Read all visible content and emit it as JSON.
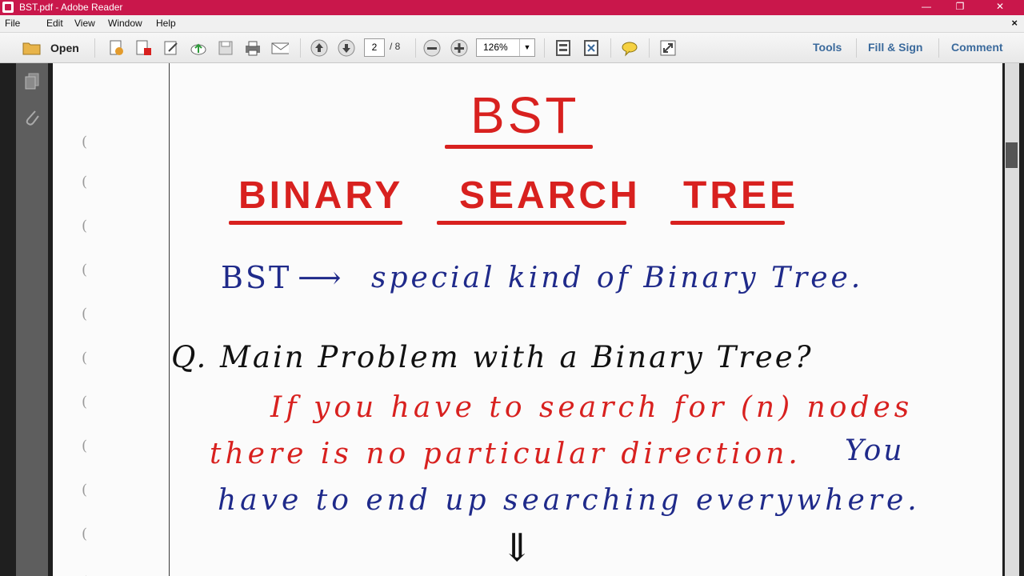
{
  "window": {
    "title": "BST.pdf - Adobe Reader"
  },
  "menu": [
    "File",
    "Edit",
    "View",
    "Window",
    "Help"
  ],
  "toolbar": {
    "open_label": "Open",
    "page_current": "2",
    "page_total": "/ 8",
    "zoom": "126%",
    "tools_label": "Tools",
    "fill_sign_label": "Fill & Sign",
    "comment_label": "Comment"
  },
  "document": {
    "heading": "BST",
    "title_words": [
      "BINARY",
      "SEARCH",
      "TREE"
    ],
    "definition_term": "BST",
    "definition_arrow": "⟶",
    "definition_text": "special kind of Binary Tree.",
    "question": "Q. Main Problem with a Binary Tree?",
    "answer_line1": "If you have to search for (n) nodes",
    "answer_line2_red": "there is no particular direction.",
    "answer_line2_blue": "You",
    "answer_line3": "have to end up searching everywhere.",
    "down_arrow": "⇓"
  },
  "colors": {
    "title_bar": "#c9174b",
    "ink_red": "#d8211f",
    "ink_blue": "#1f2a8a",
    "link": "#3b6a9c"
  }
}
